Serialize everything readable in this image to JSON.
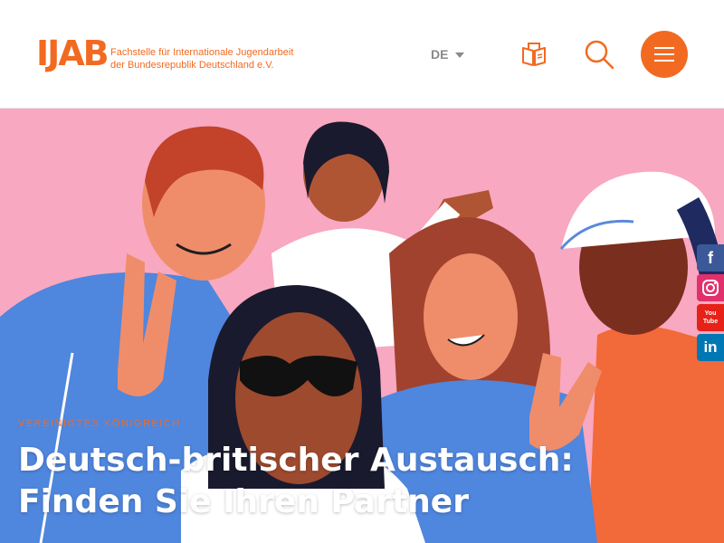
{
  "header": {
    "logo_mark": "IJAB",
    "logo_line1": "Fachstelle für Internationale Jugendarbeit",
    "logo_line2": "der Bundesrepublik Deutschland e.V.",
    "language": "DE"
  },
  "icons": {
    "book": "book-icon",
    "search": "search-icon",
    "menu": "hamburger-menu-icon",
    "facebook": "facebook-icon",
    "instagram": "instagram-icon",
    "youtube": "youtube-icon",
    "linkedin": "linkedin-icon"
  },
  "social": {
    "facebook": "f",
    "youtube": "You Tube",
    "linkedin": "in"
  },
  "hero": {
    "category": "Vereinigtes Königreich",
    "title": "Deutsch-britischer Austausch: Finden Sie Ihren Partner"
  },
  "colors": {
    "brand": "#f26a21",
    "hero_background": "#f8a8c0",
    "facebook": "#3b5998",
    "instagram": "#e1306c",
    "youtube": "#e62117",
    "linkedin": "#0077b5"
  }
}
